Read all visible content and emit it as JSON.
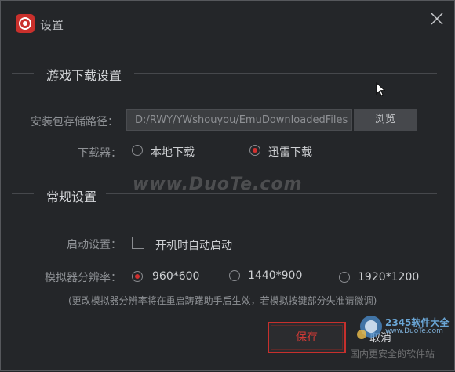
{
  "window": {
    "title": "设置"
  },
  "download_section": {
    "title": "游戏下载设置",
    "path_label": "安装包存储路径：",
    "path_value": "D:/RWY/YWshouyou/EmuDownloadedFiles",
    "browse_label": "浏览",
    "downloader_label": "下载器：",
    "options": [
      {
        "label": "本地下载",
        "selected": false
      },
      {
        "label": "迅雷下载",
        "selected": true
      }
    ]
  },
  "general_section": {
    "title": "常规设置",
    "startup_label": "启动设置：",
    "autostart_label": "开机时自动启动",
    "autostart_checked": false,
    "resolution_label": "模拟器分辨率：",
    "resolutions": [
      {
        "label": "960*600",
        "selected": true
      },
      {
        "label": "1440*900",
        "selected": false
      },
      {
        "label": "1920*1200",
        "selected": false
      }
    ],
    "note": "(更改模拟器分辨率将在重启踌躇助手后生效，若模拟按键部分失准请微调)"
  },
  "buttons": {
    "save": "保存",
    "cancel": "取消"
  },
  "watermarks": {
    "center": "www.DuoTe.com",
    "site_name": "2345软件大全",
    "site_url": "www.DuoTe.com",
    "slogan": "国内更安全的软件站"
  },
  "colors": {
    "accent": "#d1302f",
    "background": "#242629"
  }
}
